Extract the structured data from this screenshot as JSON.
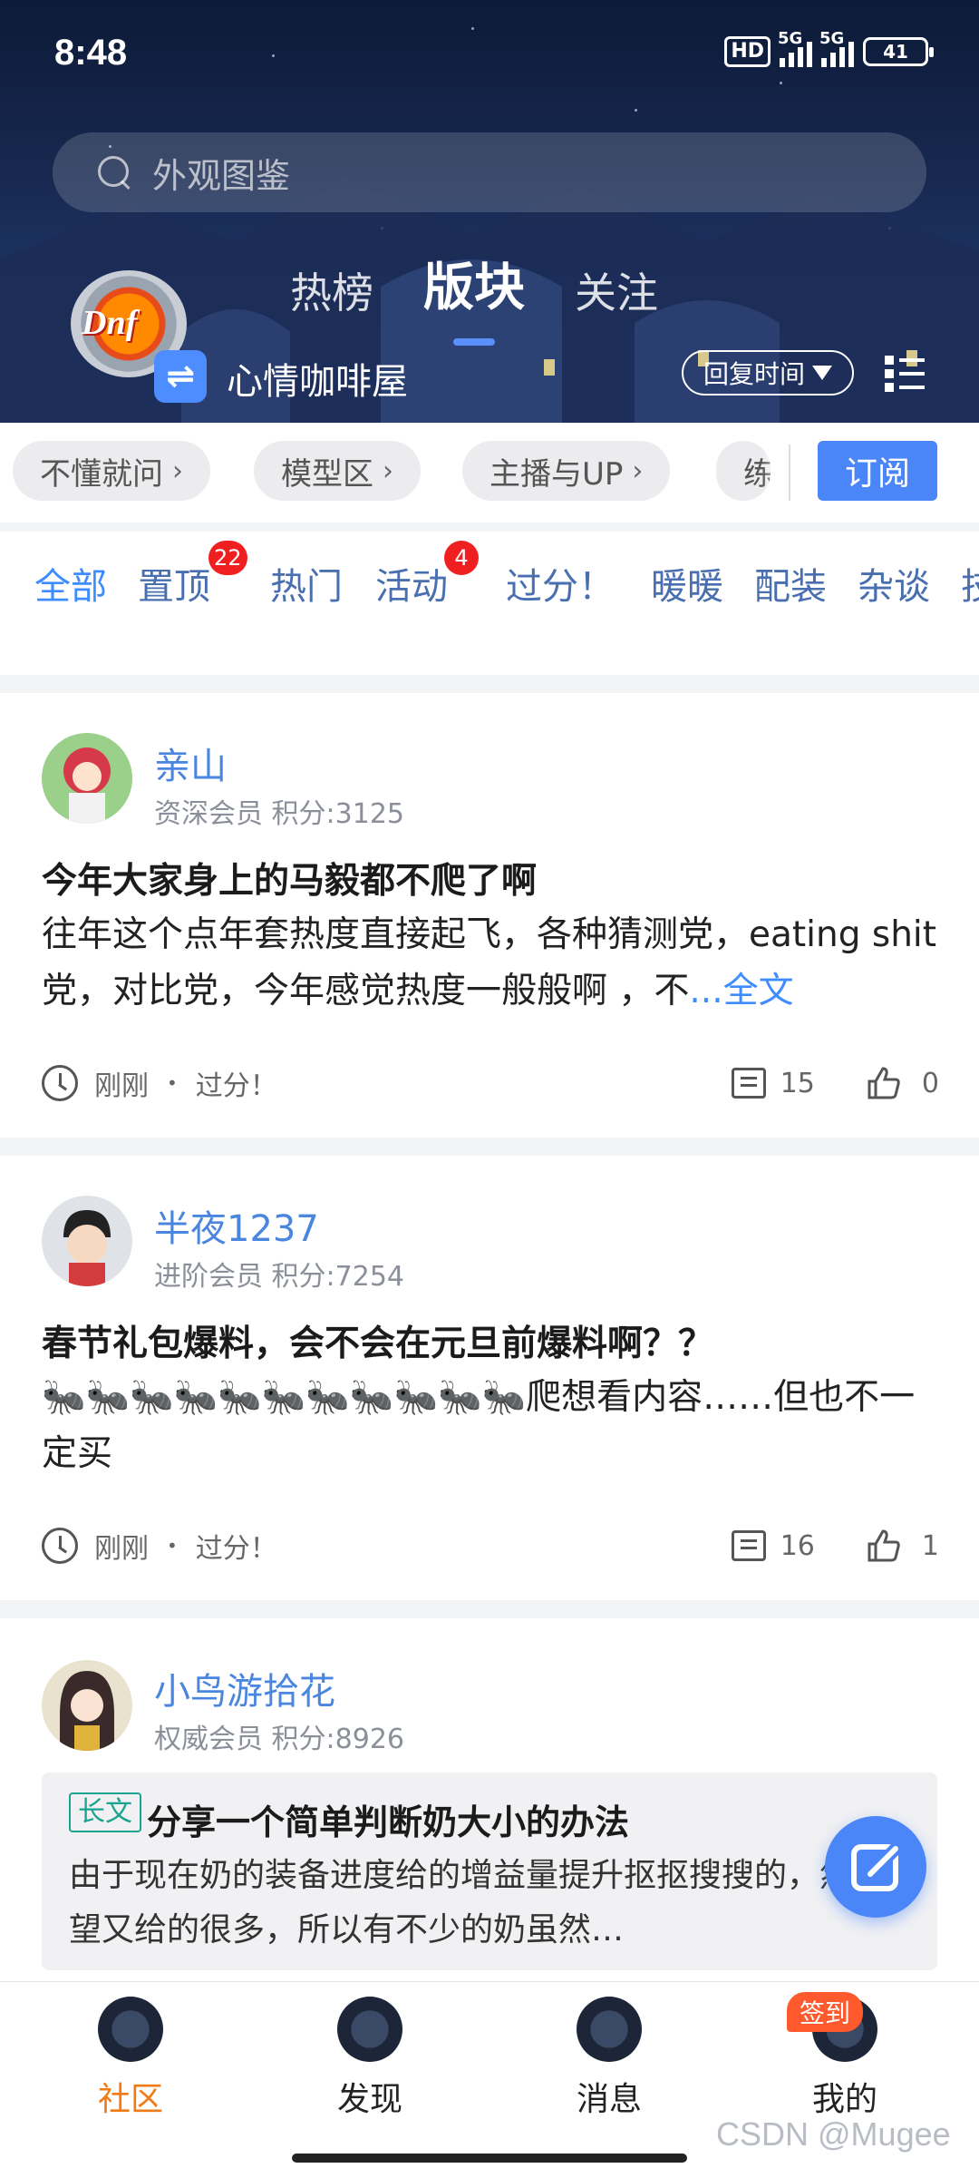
{
  "status_bar": {
    "time": "8:48",
    "hd": "HD",
    "net1": "5G",
    "net2": "5G",
    "battery": "41"
  },
  "search": {
    "placeholder": "外观图鉴"
  },
  "header_tabs": [
    {
      "label": "热榜",
      "active": false
    },
    {
      "label": "版块",
      "active": true
    },
    {
      "label": "关注",
      "active": false
    }
  ],
  "board": {
    "logo_text": "Dnf",
    "name": "心情咖啡屋",
    "sort_label": "回复时间"
  },
  "sub_boards": [
    "不懂就问",
    "模型区",
    "主播与UP",
    "练"
  ],
  "subscribe_label": "订阅",
  "categories": [
    {
      "label": "全部",
      "active": true
    },
    {
      "label": "置顶",
      "badge": "22"
    },
    {
      "label": "热门"
    },
    {
      "label": "活动",
      "badge": "4"
    },
    {
      "label": "过分！"
    },
    {
      "label": "暖暖"
    },
    {
      "label": "配装"
    },
    {
      "label": "杂谈"
    },
    {
      "label": "技"
    }
  ],
  "posts": [
    {
      "user": "亲山",
      "meta": "资深会员  积分:3125",
      "title": "今年大家身上的马毅都不爬了啊",
      "body": "往年这个点年套热度直接起飞，各种猜测党，eating shit党，对比党，今年感觉热度一般般啊 ，不",
      "more": "...全文",
      "time": "刚刚",
      "category": "过分！",
      "comments": "15",
      "likes": "0"
    },
    {
      "user": "半夜1237",
      "meta": "进阶会员  积分:7254",
      "title": "春节礼包爆料，会不会在元旦前爆料啊？？",
      "body": "🐜🐜🐜🐜🐜🐜🐜🐜🐜🐜🐜爬想看内容……但也不一定买",
      "time": "刚刚",
      "category": "过分！",
      "comments": "16",
      "likes": "1"
    },
    {
      "user": "小鸟游拾花",
      "meta": "权威会员  积分:8926",
      "tag": "长文",
      "title": "分享一个简单判断奶大小的办法",
      "body": "由于现在奶的装备进度给的增益量提升抠抠搜搜的，然后名望又给的很多，所以有不少的奶虽然…"
    }
  ],
  "bottom_nav": [
    {
      "label": "社区",
      "active": true
    },
    {
      "label": "发现"
    },
    {
      "label": "消息"
    },
    {
      "label": "我的"
    }
  ],
  "signin_badge": "签到",
  "watermark": "CSDN @Mugee",
  "colors": {
    "accent": "#4a86f7",
    "active_nav": "#f07a14",
    "badge": "#f02020",
    "username": "#4a86e0"
  }
}
